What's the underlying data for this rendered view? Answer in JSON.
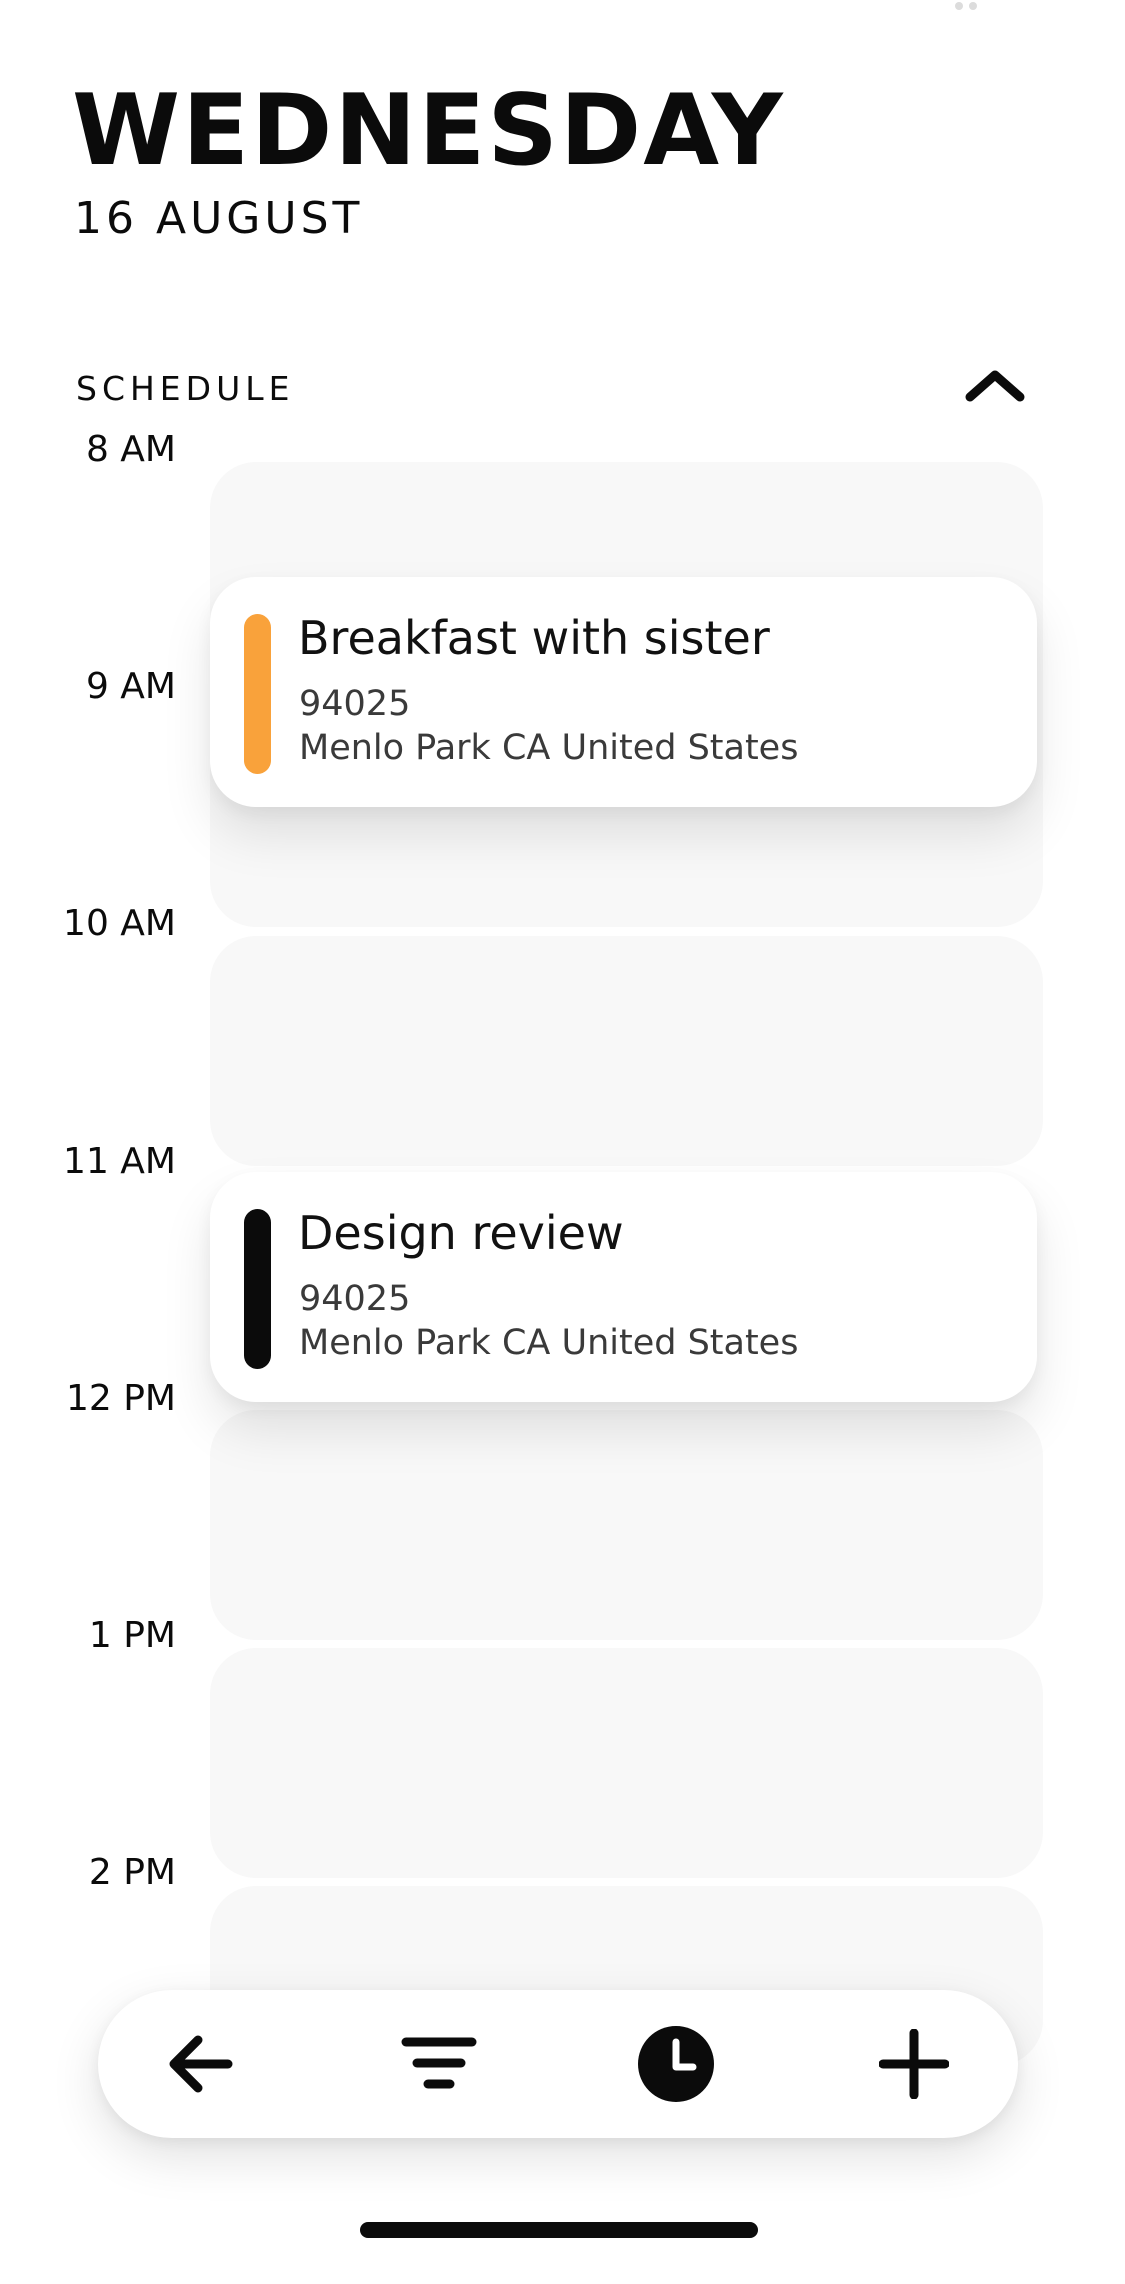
{
  "header": {
    "day": "WEDNESDAY",
    "date": "16 AUGUST"
  },
  "schedule": {
    "label": "SCHEDULE",
    "collapse_icon": "chevron-up-icon",
    "times": [
      "8 AM",
      "9 AM",
      "10 AM",
      "11 AM",
      "12 PM",
      "1 PM",
      "2 PM"
    ],
    "events": [
      {
        "title": "Breakfast with sister",
        "postal_code": "94025",
        "location": "Menlo Park CA United States",
        "color": "#F9A23B"
      },
      {
        "title": "Design review",
        "postal_code": "94025",
        "location": "Menlo Park CA United States",
        "color": "#0B0B0B"
      }
    ]
  },
  "toolbar": {
    "items": [
      {
        "icon": "arrow-left-icon"
      },
      {
        "icon": "filter-icon"
      },
      {
        "icon": "clock-icon"
      },
      {
        "icon": "plus-icon"
      }
    ]
  },
  "colors": {
    "background": "#FFFFFF",
    "slot": "#F8F8F8",
    "text": "#0B0B0B",
    "accent_orange": "#F9A23B"
  }
}
